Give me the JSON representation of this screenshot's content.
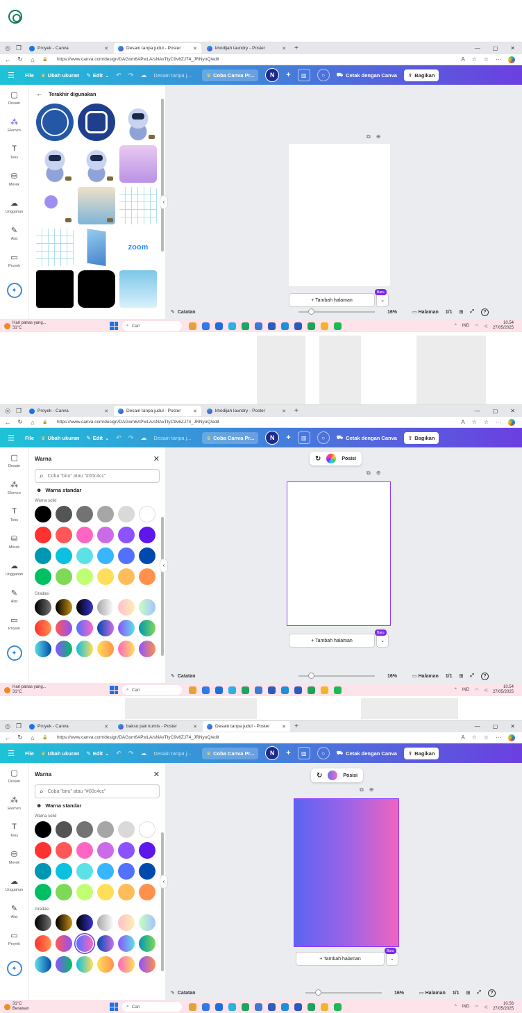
{
  "browser": {
    "tabs_a": [
      {
        "title": "Proyek - Canva",
        "active": false
      },
      {
        "title": "Desain tanpa judul - Poster",
        "active": true
      },
      {
        "title": "khodijah laundry - Poster",
        "active": false
      }
    ],
    "tabs_c": [
      {
        "title": "Proyek - Canva",
        "active": false
      },
      {
        "title": "bakso pak kumis - Poster",
        "active": false
      },
      {
        "title": "Desain tanpa judul - Poster",
        "active": true
      }
    ],
    "url_a": "https://www.canva.com/design/DAGom6APwLA/sNAxTtyC9v6ZJ74_JRNyoQ/edit",
    "url_c": "https://www.canva.com/design/DAGom6APwLA/sNAxTtyC9v6ZJ74_JRNyoQ/edit"
  },
  "header": {
    "file": "File",
    "resize": "Ubah ukuran",
    "edit": "Edit",
    "title": "Desain tanpa j...",
    "trial": "Coba Canva Pr...",
    "avatar": "N",
    "print": "Cetak dengan Canva",
    "share": "Bagikan"
  },
  "rail": [
    {
      "label": "Desain",
      "icon": "layout-icon"
    },
    {
      "label": "Elemen",
      "icon": "shapes-icon"
    },
    {
      "label": "Teks",
      "icon": "text-icon"
    },
    {
      "label": "Merek",
      "icon": "brand-icon"
    },
    {
      "label": "Unggahan",
      "icon": "upload-icon"
    },
    {
      "label": "Alat",
      "icon": "draw-icon"
    },
    {
      "label": "Proyek",
      "icon": "folder-icon"
    }
  ],
  "elements_panel": {
    "heading": "Terakhir digunakan",
    "zoom_label": "zoom"
  },
  "color_panel": {
    "title": "Warna",
    "search_placeholder": "Coba \"biru\" atau \"#00c4cc\"",
    "standard": "Warna standar",
    "solid_label": "Warna solid",
    "gradient_label": "Gradasi",
    "solid": [
      "#000000",
      "#545454",
      "#737373",
      "#a6a6a6",
      "#d9d9d9",
      "#ffffff",
      "#ff3131",
      "#ff5757",
      "#ff66c4",
      "#cb6ce6",
      "#8c52ff",
      "#5e17eb",
      "#0097b2",
      "#0cc0df",
      "#5ce1e6",
      "#38b6ff",
      "#5271ff",
      "#004aad",
      "#00bf63",
      "#7ed957",
      "#c1ff72",
      "#ffde59",
      "#ffbd59",
      "#ff914d"
    ],
    "gradients": [
      "linear-gradient(90deg,#000000,#737373)",
      "linear-gradient(90deg,#000000,#c89116)",
      "linear-gradient(90deg,#000000,#3533cd)",
      "linear-gradient(90deg,#a6a6a6,#ffffff)",
      "linear-gradient(90deg,#ffc0cb,#ffeeb5)",
      "linear-gradient(90deg,#c9ffbf,#a3c3ff)",
      "linear-gradient(90deg,#ff3131,#ff914d)",
      "linear-gradient(90deg,#ff5757,#8c52ff)",
      "linear-gradient(90deg,#5170ff,#ff66c4)",
      "linear-gradient(90deg,#004aad,#cb6ce6)",
      "linear-gradient(90deg,#8c52ff,#5ce1e6)",
      "linear-gradient(90deg,#0097b2,#7ed957)",
      "linear-gradient(90deg,#5de0e6,#004aad)",
      "linear-gradient(90deg,#8c52ff,#00bf63)",
      "linear-gradient(90deg,#0cc0df,#ffde59)",
      "linear-gradient(90deg,#ffde59,#ff914d)",
      "linear-gradient(90deg,#ff66c4,#ffde59)",
      "linear-gradient(90deg,#8c52ff,#ff914d)"
    ],
    "selected_gradient_index": 8
  },
  "canvas": {
    "context_position": "Posisi",
    "add_page": "+ Tambah halaman",
    "new_badge": "Baru",
    "notes": "Catatan",
    "zoom": "16%",
    "pages_label": "Halaman",
    "pages": "1/1"
  },
  "taskbar": {
    "weather_a": "Hari panas yang...",
    "temp": "31°C",
    "weather_c": "Berawan",
    "search": "Cari",
    "lang": "IND",
    "time_a": "10.54",
    "time_c": "10.56",
    "date": "27/05/2025"
  },
  "colors": {
    "accent": "#8b3dff",
    "header_start": "#1ec3d7",
    "header_end": "#6b3fe0"
  }
}
